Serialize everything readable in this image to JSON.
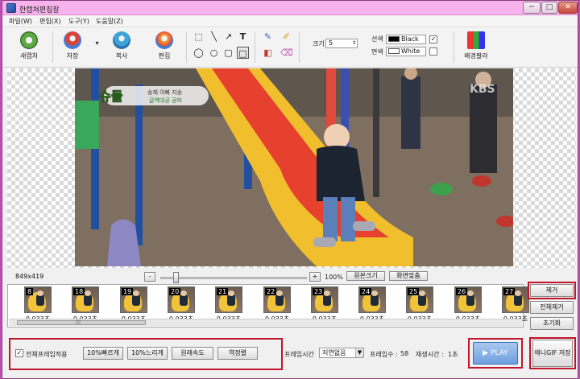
{
  "window": {
    "title": "한캡쳐편집장",
    "min_label": "─",
    "max_label": "□",
    "close_label": "✕"
  },
  "menu": [
    "파일(W)",
    "편집(X)",
    "도구(Y)",
    "도움말(Z)"
  ],
  "toolbar": {
    "capture_label": "새캡처",
    "save_label": "저장",
    "copy_label": "복사",
    "edit_label": "편집",
    "text_tool": "T",
    "size_label": "크기",
    "size_value": "5",
    "line_label": "선색",
    "line_color_name": "Black",
    "line_color": "#000000",
    "fill_label": "면색",
    "fill_color_name": "White",
    "fill_color": "#ffffff",
    "palette_label": "배경팔라",
    "line_checked": "✓"
  },
  "canvas": {
    "overlay_logo": "슈돌",
    "overlay_subtitle1": "송재 아빠 지송",
    "overlay_subtitle2": "글역대공 공파",
    "watermark": "KBS"
  },
  "zoom": {
    "image_size": "849x419",
    "minus": "-",
    "plus": "+",
    "percent": "100%",
    "original_size": "원본크기",
    "fit_screen": "화면맞춤",
    "level_percent": 100
  },
  "frames": [
    {
      "num": "8",
      "dur": "0.033초"
    },
    {
      "num": "18",
      "dur": "0.033초"
    },
    {
      "num": "19",
      "dur": "0.033초"
    },
    {
      "num": "20",
      "dur": "0.033초"
    },
    {
      "num": "21",
      "dur": "0.033초"
    },
    {
      "num": "22",
      "dur": "0.033초"
    },
    {
      "num": "23",
      "dur": "0.033초"
    },
    {
      "num": "24",
      "dur": "0.033초"
    },
    {
      "num": "25",
      "dur": "0.033초"
    },
    {
      "num": "26",
      "dur": "0.033초"
    },
    {
      "num": "27",
      "dur": "0.033초"
    }
  ],
  "frames_scroll_label": "|||",
  "side": {
    "remove": "제거",
    "remove_all": "전체제거",
    "reset": "초기화"
  },
  "bottom": {
    "apply_all_label": "전체프레임적용",
    "apply_all_checked": "✓",
    "faster": "10%빠르게",
    "slower": "10%느리게",
    "original_speed": "원래속도",
    "reverse": "역정렬",
    "frame_time_label": "프레임시간",
    "frame_time_value": "지연없음",
    "frame_count_label": "프레임수 :",
    "frame_count": "58",
    "play_time_label": "재생시간 :",
    "play_time": "1초",
    "play": "▶ PLAY",
    "save_gif": "애니GIF 저장"
  }
}
